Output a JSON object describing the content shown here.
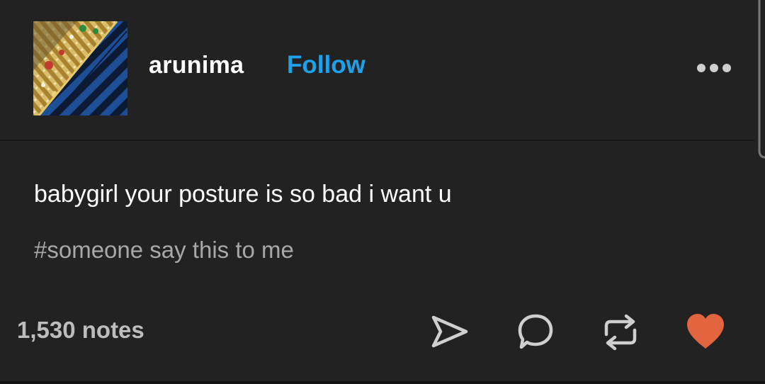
{
  "post": {
    "author": {
      "username": "arunima",
      "follow_label": "Follow",
      "avatar_icon": "fabric-avatar-image"
    },
    "menu_icon": "more-horizontal-icon",
    "text": "babygirl your posture is so bad i want u",
    "tags": [
      "#someone say this to me"
    ],
    "footer": {
      "notes_label": "1,530 notes",
      "actions": [
        {
          "name": "share",
          "icon": "share-paper-plane-icon"
        },
        {
          "name": "reply",
          "icon": "reply-bubble-icon"
        },
        {
          "name": "reblog",
          "icon": "reblog-icon"
        },
        {
          "name": "like",
          "icon": "heart-icon",
          "active": true
        }
      ]
    }
  },
  "colors": {
    "background": "#222222",
    "text": "#ffffff",
    "tag": "#a8a8a8",
    "notes": "#bdbdbd",
    "follow": "#1fa0ea",
    "heart": "#e2653f",
    "icon": "#cfcfcf"
  }
}
